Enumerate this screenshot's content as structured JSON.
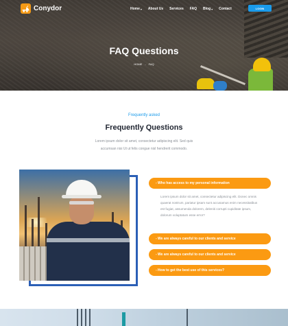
{
  "brand": {
    "name": "Conydor"
  },
  "nav": {
    "items": [
      {
        "label": "Home",
        "dropdown": true
      },
      {
        "label": "About Us",
        "dropdown": false
      },
      {
        "label": "Services",
        "dropdown": false
      },
      {
        "label": "FAQ",
        "dropdown": false
      },
      {
        "label": "Blog",
        "dropdown": true
      },
      {
        "label": "Contact",
        "dropdown": false
      }
    ],
    "login_label": "LOGIN"
  },
  "hero": {
    "title": "FAQ Questions",
    "breadcrumb": {
      "home": "HOME",
      "separator": "-",
      "current": "FAQ"
    }
  },
  "faq": {
    "eyebrow": "Frequently asked",
    "title": "Frequently Questions",
    "intro_line1": "Lorem ipsum dolor sit amet, consectetur adipiscing elit. Sed quis",
    "intro_line2": "accumsan nisi Ut ut felis congue nisl hendrerit commodo.",
    "items": [
      {
        "question": "- Who has access to my personal information",
        "expanded": true,
        "answer": "Lorem ipsum dolor sit amet, consectetur adipiscing elit. Donec omnis quaerat nostrum, pariatur ipsam sunt accusamus enim necessitatibus est fugiat, assumenda dolorem, deleniti corrupti cupiditate ipsum, dolorum voluptatum esse error?"
      },
      {
        "question": "- We are always careful to our clients and service",
        "expanded": false
      },
      {
        "question": "- We are always careful to our clients and service",
        "expanded": false
      },
      {
        "question": "- How to get the best use of this services?",
        "expanded": false
      }
    ]
  },
  "colors": {
    "accent": "#fb9a12",
    "primary": "#1b9bea",
    "frame": "#2b5fb6"
  }
}
